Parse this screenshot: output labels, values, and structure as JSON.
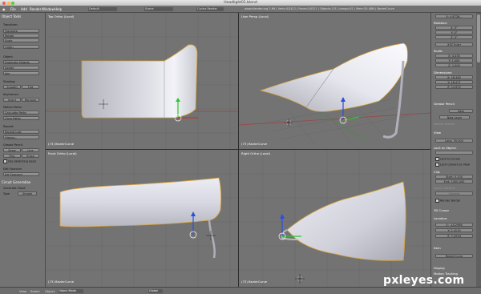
{
  "window": {
    "title": "Headlight01.blend",
    "traffic_lights": [
      "#ec5f57",
      "#f5bd3a",
      "#5fc544"
    ]
  },
  "menubar": {
    "items": [
      "File",
      "Add",
      "Render",
      "Window",
      "Help"
    ],
    "layout_field": "Default",
    "scene_field": "Scene",
    "engine_field": "Cycles Render",
    "stats": "www.blender.org 2.69 | Verts:0/2412 | Faces:0/4311 | Objects:1/3 | Lamps:0/1 | Mem:30.48M | BezierCurve"
  },
  "left_panel": {
    "header": "Object Tools",
    "sections": [
      {
        "title": "Transform:",
        "buttons": [
          "Translate",
          "Rotate",
          "Scale",
          "Origin"
        ]
      },
      {
        "title": "Object:",
        "buttons": [
          "Duplicate Objects",
          "Delete",
          "Join"
        ]
      },
      {
        "title": "Shading:",
        "pair": [
          "Smooth",
          "Flat"
        ]
      },
      {
        "title": "Keyframes:",
        "pair": [
          "Insert",
          "Remove"
        ]
      },
      {
        "title": "Motion Paths:",
        "buttons": [
          "Calculate Paths",
          "Clear Paths"
        ]
      },
      {
        "title": "Repeat:",
        "buttons": [
          "Repeat Last",
          "History..."
        ]
      },
      {
        "title": "Grease Pencil:",
        "pair": [
          "Draw",
          "Line"
        ],
        "pair2": [
          "Poly",
          "Erase"
        ],
        "check": "Use Sketching Sessi"
      }
    ],
    "extra_title": "Edit Fourcorn",
    "extra_button": "Set Fourcorn",
    "curve_header": "Circuit Generation",
    "curve_label": "Generate Cloud",
    "type_label": "Type",
    "type_value": "Simple"
  },
  "viewports": {
    "top_left": {
      "label": "Top Ortho (Local)",
      "object": "(73) BezierCurve"
    },
    "top_right": {
      "label": "User Persp (Local)",
      "object": "(73) BezierCurve"
    },
    "bottom_left": {
      "label": "Front Ortho (Local)",
      "object": "(73) BezierCurve"
    },
    "bottom_right": {
      "label": "Right Ortho (Local)",
      "object": "(73) BezierCurve"
    }
  },
  "right_panel": {
    "rot_top": "X: 4.6726...",
    "rotation_label": "Rotation:",
    "rotation": [
      "X: 0°",
      "Y: 0°",
      "Z: 0°"
    ],
    "rot_mode": "XYZ Euler",
    "scale_label": "Scale:",
    "scale": [
      "X: 4.430",
      "Y: 1.000",
      "Z: 1.000"
    ],
    "dimensions_label": "Dimensions:",
    "dimensions": [
      "X: 18.462",
      "Y: 18.477",
      "Z: 14.672"
    ],
    "grease_label": "Grease Pencil",
    "grease_new": "New",
    "grease_new_layer": "New Layer",
    "grease_delete": "Delete Frame",
    "view_label": "View",
    "lens": "Lens: 35.000",
    "lock_label": "Lock to Object:",
    "lock_cursor": "Lock to Cursor",
    "lock_camera": "Lock Camera to View",
    "clip_label": "Clip:",
    "clip_start": "Start: 0.100",
    "clip_end": "End: 1000.000",
    "local_camera": "Local Camera:",
    "camera_field": "Camera",
    "render_border": "Render Border",
    "cursor_label": "3D Cursor",
    "location_label": "Location:",
    "location": [
      "X: -14.2966",
      "Y: 2.4119",
      "Z: 7.4934"
    ],
    "item_label": "Item",
    "item_name": "BezierCurve",
    "display_label": "Display",
    "motion_label": "Motion Tracking"
  },
  "statusbar": {
    "view": "View",
    "select": "Select",
    "object": "Object",
    "mode": "Object Mode",
    "global": "Global"
  },
  "watermark": "pxleyes.com"
}
